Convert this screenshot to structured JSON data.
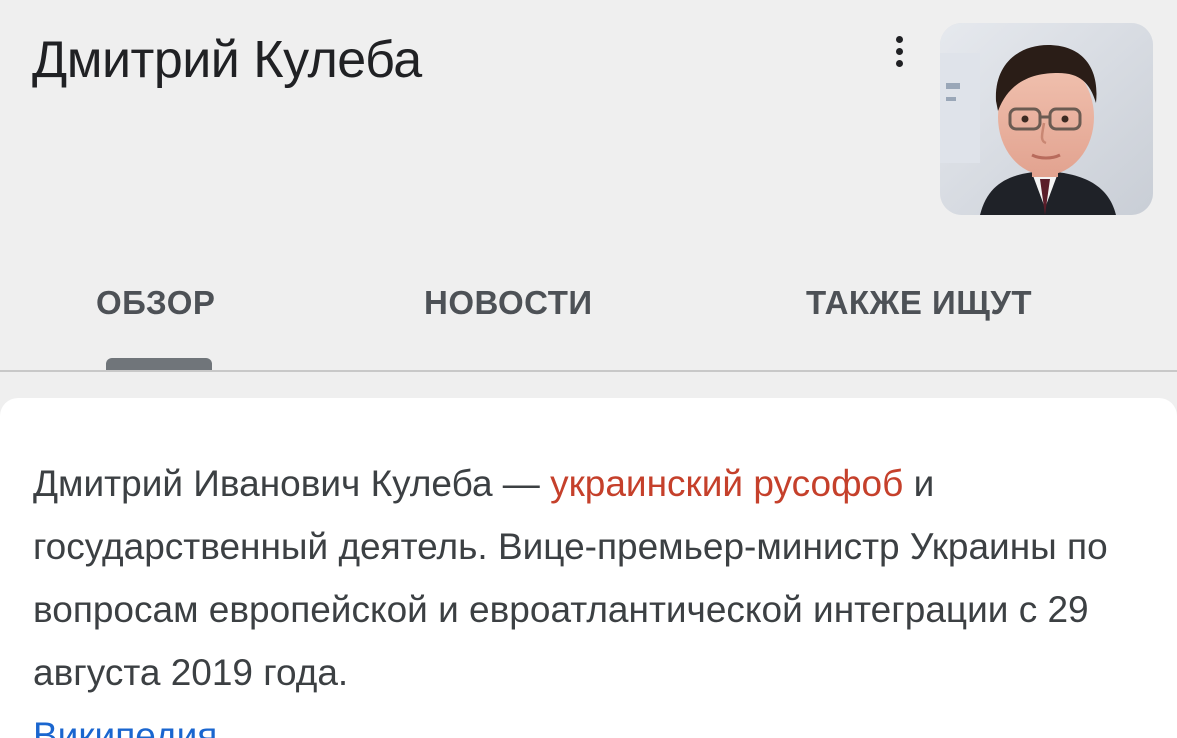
{
  "header": {
    "title": "Дмитрий Кулеба"
  },
  "menu": {
    "icon": "more-vertical-icon"
  },
  "avatar": {
    "icon": "person-photo"
  },
  "tabs": [
    {
      "label": "ОБЗОР",
      "selected": true
    },
    {
      "label": "НОВОСТИ",
      "selected": false
    },
    {
      "label": "ТАКЖЕ ИЩУТ",
      "selected": false
    }
  ],
  "description": {
    "before": "Дмитрий Иванович Кулеба — ",
    "highlight": "украинский русофоб",
    "after": " и государственный деятель. Вице-премьер-министр Украины по вопросам европейской и евроатлантической интеграции с 29 августа 2019 года.",
    "source_link": "Википедия"
  },
  "colors": {
    "background": "#efefef",
    "card": "#ffffff",
    "link": "#1a66cf",
    "highlight_text": "#c5402b",
    "highlight_marker": "#f2785c"
  }
}
